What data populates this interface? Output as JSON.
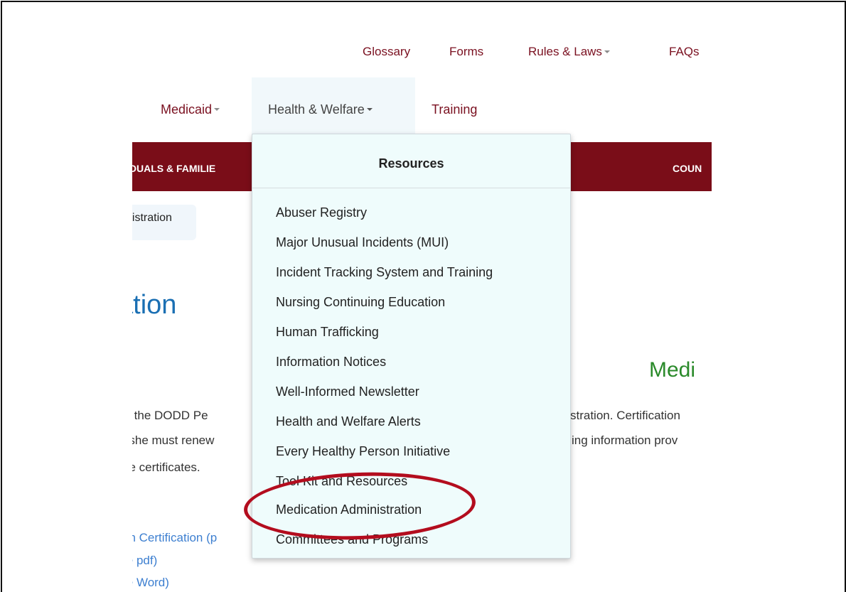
{
  "utility_nav": {
    "glossary": "Glossary",
    "forms": "Forms",
    "rules_laws": "Rules & Laws",
    "faqs": "FAQs"
  },
  "main_nav": {
    "medicaid": "Medicaid",
    "health_welfare": "Health & Welfare",
    "training": "Training"
  },
  "section_bar": {
    "left": "IDUALS & FAMILIE",
    "right": "COUN"
  },
  "breadcrumb": {
    "current": "nistration"
  },
  "page": {
    "title": "ation",
    "side_heading": "Medi",
    "body": [
      "ch the DODD Pe",
      "r she must renew",
      "se certificates.",
      "stration. Certification",
      "ing information prov"
    ],
    "links": [
      "on Certification (p",
      "le pdf)",
      "le Word)"
    ]
  },
  "dropdown": {
    "heading": "Resources",
    "items": [
      "Abuser Registry",
      "Major Unusual Incidents (MUI)",
      "Incident Tracking System and Training",
      "Nursing Continuing Education",
      "Human Trafficking",
      "Information Notices",
      "Well-Informed Newsletter",
      "Health and Welfare Alerts",
      "Every Healthy Person Initiative",
      "Tool Kit and Resources",
      "Medication Administration",
      "Committees and Programs"
    ]
  },
  "colors": {
    "maroon": "#7a0d18",
    "link": "#7a1020",
    "highlight_circle": "#b30d1e",
    "title_blue": "#1a6fb3",
    "heading_green": "#2a8a2a"
  }
}
